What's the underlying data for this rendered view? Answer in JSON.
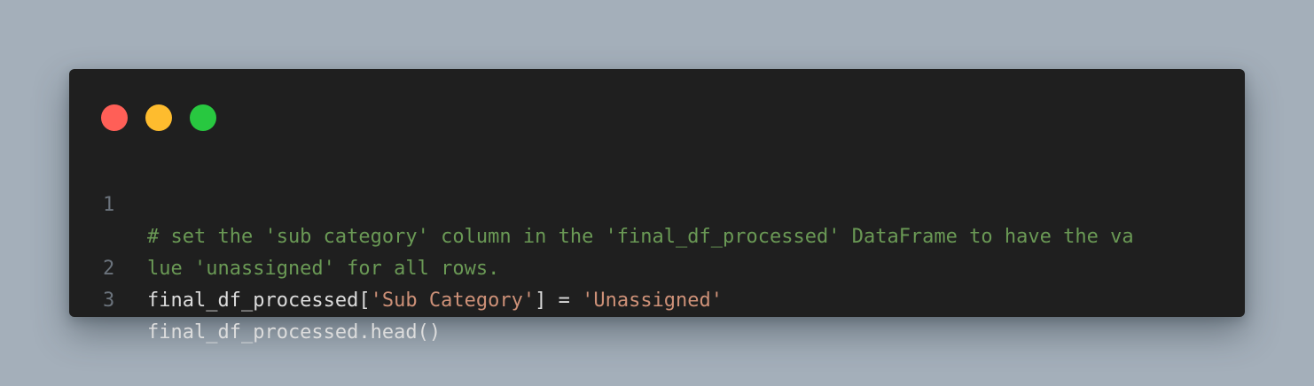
{
  "window": {
    "traffic_lights": [
      {
        "name": "close",
        "color": "#ff5f57"
      },
      {
        "name": "minimize",
        "color": "#febc2e"
      },
      {
        "name": "maximize",
        "color": "#28c840"
      }
    ]
  },
  "code": {
    "lines": [
      {
        "number": "1",
        "segments": [
          {
            "type": "comment",
            "text": "# set the 'sub category' column in the 'final_df_processed' DataFrame to have the va"
          }
        ]
      },
      {
        "number": "",
        "segments": [
          {
            "type": "comment",
            "text": "lue 'unassigned' for all rows."
          }
        ]
      },
      {
        "number": "2",
        "segments": [
          {
            "type": "plain",
            "text": "final_df_processed["
          },
          {
            "type": "string",
            "text": "'Sub Category'"
          },
          {
            "type": "plain",
            "text": "] = "
          },
          {
            "type": "string",
            "text": "'Unassigned'"
          }
        ]
      },
      {
        "number": "3",
        "segments": [
          {
            "type": "plain",
            "text": "final_df_processed.head()"
          }
        ]
      }
    ]
  },
  "colors": {
    "background": "#a4afba",
    "panel": "#1f1f1f",
    "comment": "#6a9955",
    "string": "#ce9178",
    "text": "#dcdcdc",
    "line_number": "#6b737c"
  }
}
